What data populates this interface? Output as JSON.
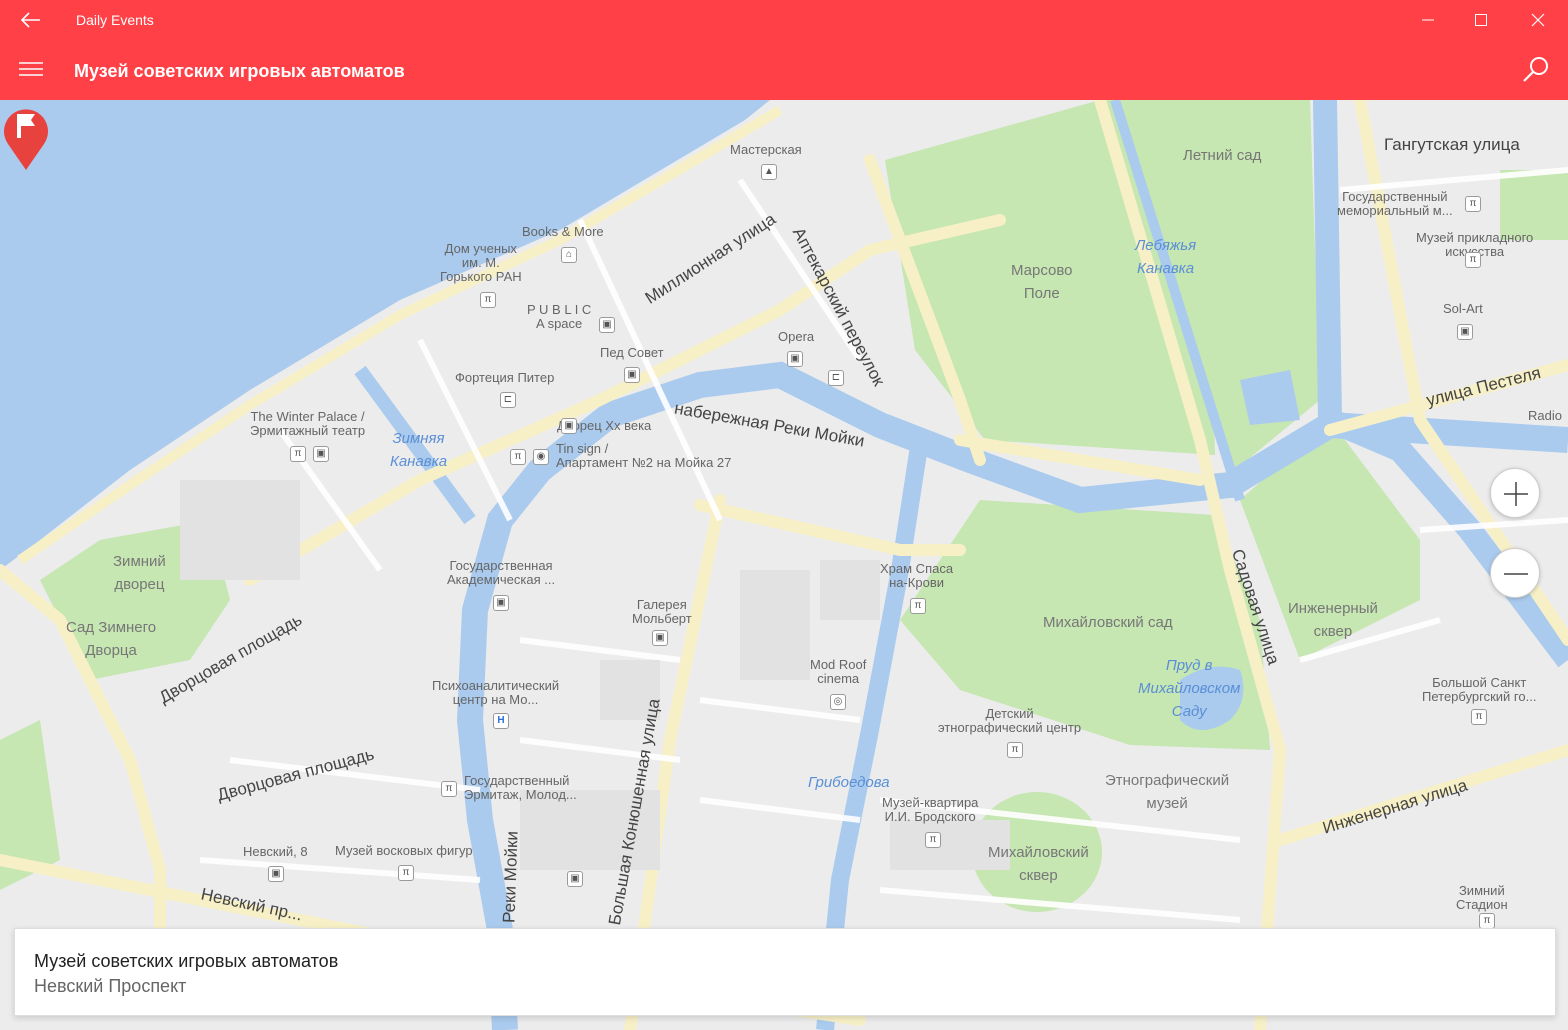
{
  "window": {
    "title": "Daily Events"
  },
  "appbar": {
    "page_title": "Музей советских игровых автоматов"
  },
  "map": {
    "labels": {
      "masterskaya": "Мастерская",
      "books_more": "Books & More",
      "dom_uchenyh": "Дом ученых\nим. М.\nГорького РАН",
      "public_space": "P U B L I C\nA space",
      "ped_sovet": "Пед Совет",
      "opera": "Opera",
      "fortecia": "Фортеция Питер",
      "winter_palace_theatre": "The Winter Palace /\nЭрмитажный театр",
      "dvorec_xx": "Дворец Хх века",
      "tin_sign": "Tin sign /\nАпартамент №2 на Мойка 27",
      "akademicheskaya": "Государственная\nАкадемическая ...",
      "galereya": "Галерея\nМольберт",
      "psychoanalytic": "Психоаналитический\nцентр на Мо...",
      "hermitage": "Государственный\nЭрмитаж, Молод...",
      "nevsky_8": "Невский, 8",
      "wax_museum": "Музей восковых фигур",
      "mod_roof": "Mod Roof\ncinema",
      "hram": "Храм Спаса\nна-Крови",
      "kids_ethno": "Детский\nэтнографический центр",
      "ethno_museum": "Этнографический\nмузей",
      "brodsky": "Музей-квартира\nИ.И. Бродского",
      "memorial": "Государственный\nмемориальный м...",
      "applied_art": "Музей прикладного\nискусства",
      "sol_art": "Sol-Art",
      "bolshoi_circus": "Большой Санкт\nПетербургский го...",
      "zimny_stadion": "Зимний\nСтадион",
      "radio": "Radio",
      "letny_sad": "Летний сад",
      "marsovo_pole": "Марсово\nПоле",
      "zimny_dvorec": "Зимний\nдворец",
      "sad_zimnego": "Сад Зимнего\nДворца",
      "mihailovsky_sad": "Михайловский сад",
      "ingenerny_skver": "Инженерный\nсквер",
      "mihailovsky_skver": "Михайловский\nсквер",
      "lebyazhya": "Лебяжья\nКанавка",
      "zimnyaya": "Зимняя\nКанавка",
      "prud": "Пруд в\nМихайловском\nСаду",
      "griboedova": "Грибоедова"
    },
    "streets": {
      "millionnaya": "Миллионная улица",
      "aptekarsky": "Аптекарский переулок",
      "naberezhnaya_moiki": "набережная Реки Мойки",
      "gangutskaya": "Гангутская улица",
      "pestelya": "улица Пестеля",
      "sadovaya": "Садовая улица",
      "ingenernaya": "Инженерная улица",
      "dvorcovaya1": "Дворцовая площадь",
      "dvorcovaya2": "Дворцовая площадь",
      "konyushennaya": "Большая Конюшенная улица",
      "nevsky": "Невский пр...",
      "reki_moiki": "Реки Мойки"
    }
  },
  "info_card": {
    "title": "Музей советских игровых автоматов",
    "subtitle": "Невский Проспект"
  },
  "colors": {
    "accent": "#ff4047",
    "water": "#aacbee",
    "park": "#c6e6b2",
    "road": "#f7f0c7",
    "pin": "#e8423f"
  }
}
